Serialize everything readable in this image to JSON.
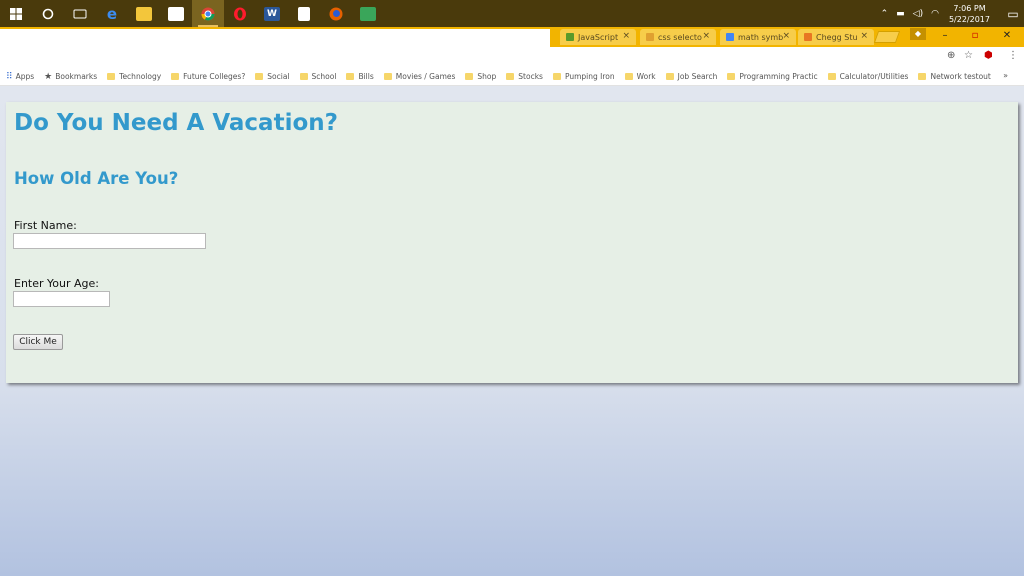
{
  "taskbar": {
    "apps": [
      {
        "name": "windows-start",
        "glyph": "⊞"
      },
      {
        "name": "cortana",
        "glyph": "○"
      },
      {
        "name": "task-view",
        "glyph": "▭"
      },
      {
        "name": "edge",
        "glyph": "e"
      },
      {
        "name": "file-explorer",
        "glyph": "▬"
      },
      {
        "name": "store",
        "glyph": "▣"
      },
      {
        "name": "chrome",
        "glyph": "◉"
      },
      {
        "name": "opera",
        "glyph": "O"
      },
      {
        "name": "word",
        "glyph": "W"
      },
      {
        "name": "calculator",
        "glyph": "▦"
      },
      {
        "name": "firefox",
        "glyph": "◕"
      },
      {
        "name": "green-app",
        "glyph": "▧"
      }
    ],
    "time": "7:06 PM",
    "date": "5/22/2017"
  },
  "browser": {
    "tabs": [
      {
        "label": "JavaScript",
        "close": "×",
        "favicon_color": "#5a9a2a"
      },
      {
        "label": "css selecto",
        "close": "×",
        "favicon_color": "#e0a030"
      },
      {
        "label": "math symb",
        "close": "×",
        "favicon_color": "#4285f4"
      },
      {
        "label": "Chegg Stu",
        "close": "×",
        "favicon_color": "#e87722"
      }
    ],
    "window_buttons": {
      "minimize": "–",
      "maximize": "▫",
      "close": "✕"
    }
  },
  "bookmarks": {
    "apps_label": "Apps",
    "bookmarks_label": "Bookmarks",
    "folders": [
      "Technology",
      "Future Colleges?",
      "Social",
      "School",
      "Bills",
      "Movies / Games",
      "Shop",
      "Stocks",
      "Pumping Iron",
      "Work",
      "Job Search",
      "Programming Practic",
      "Calculator/Utilities",
      "Network testout"
    ],
    "more": "»"
  },
  "page": {
    "title": "Do You Need A Vacation?",
    "subtitle": "How Old Are You?",
    "first_name_label": "First Name:",
    "first_name_value": "",
    "age_label": "Enter Your Age:",
    "age_value": "",
    "button_label": "Click Me"
  }
}
